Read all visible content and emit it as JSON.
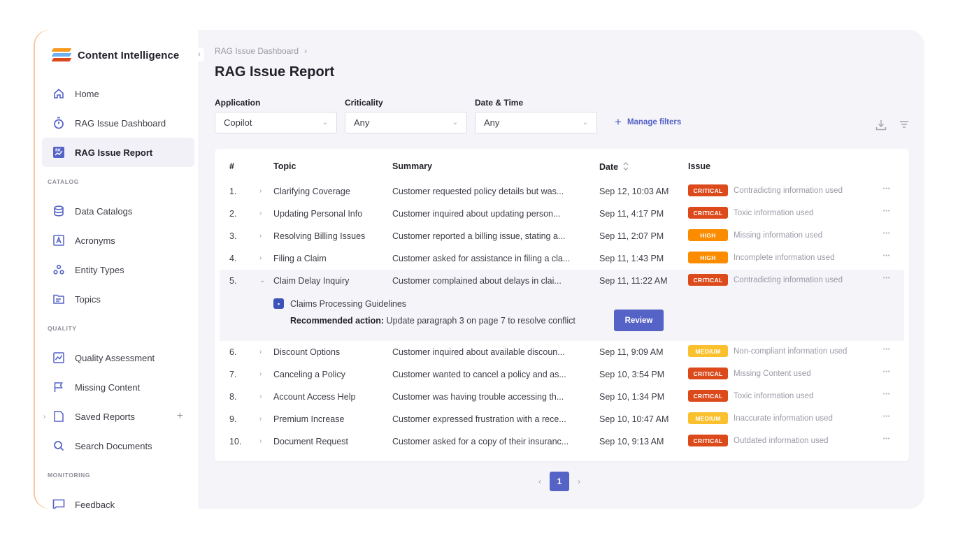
{
  "app": {
    "name": "Content Intelligence"
  },
  "colors": {
    "accent": "#5562c6",
    "critical": "#dc4a1c",
    "high": "#fb8c00",
    "medium": "#fbc02d"
  },
  "sidebar": {
    "items": [
      {
        "label": "Home",
        "icon": "home-icon"
      },
      {
        "label": "RAG Issue Dashboard",
        "icon": "stopwatch-icon"
      },
      {
        "label": "RAG Issue Report",
        "icon": "report-icon",
        "active": true
      }
    ],
    "sections": [
      {
        "title": "CATALOG",
        "items": [
          {
            "label": "Data Catalogs",
            "icon": "database-icon"
          },
          {
            "label": "Acronyms",
            "icon": "acronym-icon"
          },
          {
            "label": "Entity Types",
            "icon": "entity-icon"
          },
          {
            "label": "Topics",
            "icon": "folder-icon"
          }
        ]
      },
      {
        "title": "QUALITY",
        "items": [
          {
            "label": "Quality Assessment",
            "icon": "chart-icon"
          },
          {
            "label": "Missing Content",
            "icon": "flag-icon"
          },
          {
            "label": "Saved Reports",
            "icon": "file-icon"
          },
          {
            "label": "Search Documents",
            "icon": "search-icon"
          }
        ]
      },
      {
        "title": "MONITORING",
        "items": [
          {
            "label": "Feedback",
            "icon": "feedback-icon"
          }
        ]
      }
    ]
  },
  "breadcrumb": {
    "parent": "RAG Issue Dashboard",
    "separator": "›"
  },
  "page": {
    "title": "RAG Issue Report"
  },
  "filters": [
    {
      "label": "Application",
      "value": "Copilot"
    },
    {
      "label": "Criticality",
      "value": "Any"
    },
    {
      "label": "Date & Time",
      "value": "Any"
    }
  ],
  "manage_filters": {
    "label": "Manage filters"
  },
  "table": {
    "headers": {
      "num": "#",
      "topic": "Topic",
      "summary": "Summary",
      "date": "Date",
      "issue": "Issue"
    },
    "rows": [
      {
        "num": "1.",
        "topic": "Clarifying Coverage",
        "summary": "Customer requested policy details but was...",
        "date": "Sep 12, 10:03 AM",
        "severity": "CRITICAL",
        "issue": "Contradicting information used"
      },
      {
        "num": "2.",
        "topic": "Updating Personal Info",
        "summary": "Customer inquired about updating person...",
        "date": "Sep 11, 4:17 PM",
        "severity": "CRITICAL",
        "issue": "Toxic information used"
      },
      {
        "num": "3.",
        "topic": "Resolving Billing Issues",
        "summary": "Customer reported a billing issue, stating a...",
        "date": "Sep 11, 2:07 PM",
        "severity": "HIGH",
        "issue": "Missing information used"
      },
      {
        "num": "4.",
        "topic": "Filing a Claim",
        "summary": "Customer asked for assistance in filing a cla...",
        "date": "Sep 11, 1:43 PM",
        "severity": "HIGH",
        "issue": "Incomplete information used"
      },
      {
        "num": "5.",
        "topic": "Claim Delay Inquiry",
        "summary": "Customer complained about delays in clai...",
        "date": "Sep 11, 11:22 AM",
        "severity": "CRITICAL",
        "issue": "Contradicting information used",
        "expanded": true,
        "detail": {
          "document": "Claims Processing Guidelines",
          "action_label": "Recommended action:",
          "action_text": "Update paragraph 3 on page 7 to resolve conflict",
          "button": "Review"
        }
      },
      {
        "num": "6.",
        "topic": "Discount Options",
        "summary": "Customer inquired about available discoun...",
        "date": "Sep 11, 9:09 AM",
        "severity": "MEDIUM",
        "issue": "Non-compliant information used"
      },
      {
        "num": "7.",
        "topic": "Canceling a Policy",
        "summary": "Customer wanted to cancel a policy and as...",
        "date": "Sep 10, 3:54 PM",
        "severity": "CRITICAL",
        "issue": "Missing Content used"
      },
      {
        "num": "8.",
        "topic": "Account Access Help",
        "summary": "Customer was having trouble accessing th...",
        "date": "Sep 10, 1:34 PM",
        "severity": "CRITICAL",
        "issue": "Toxic information used"
      },
      {
        "num": "9.",
        "topic": "Premium Increase",
        "summary": "Customer expressed frustration with a rece...",
        "date": "Sep 10, 10:47 AM",
        "severity": "MEDIUM",
        "issue": "Inaccurate information used"
      },
      {
        "num": "10.",
        "topic": "Document Request",
        "summary": "Customer asked for a copy of their insuranc...",
        "date": "Sep 10, 9:13 AM",
        "severity": "CRITICAL",
        "issue": "Outdated information used"
      }
    ]
  },
  "pagination": {
    "current": "1"
  }
}
